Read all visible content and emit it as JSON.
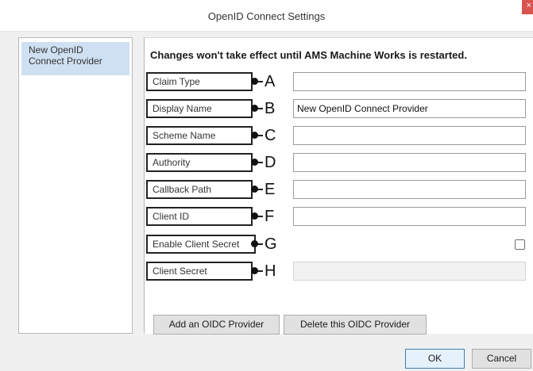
{
  "window": {
    "title": "OpenID Connect Settings",
    "close_symbol": "×"
  },
  "sidebar": {
    "items": [
      {
        "label_line1": "New OpenID",
        "label_line2": "Connect Provider"
      }
    ]
  },
  "notice": "Changes won't take effect until AMS Machine Works is restarted.",
  "fields": [
    {
      "label": "Claim Type",
      "marker": "A",
      "value": ""
    },
    {
      "label": "Display Name",
      "marker": "B",
      "value": "New OpenID Connect Provider"
    },
    {
      "label": "Scheme Name",
      "marker": "C",
      "value": ""
    },
    {
      "label": "Authority",
      "marker": "D",
      "value": ""
    },
    {
      "label": "Callback Path",
      "marker": "E",
      "value": ""
    },
    {
      "label": "Client ID",
      "marker": "F",
      "value": ""
    },
    {
      "label": "Enable Client Secret",
      "marker": "G",
      "checked": false
    },
    {
      "label": "Client Secret",
      "marker": "H",
      "value": "",
      "disabled": true
    }
  ],
  "actions": {
    "add_label": "Add an OIDC Provider",
    "delete_label": "Delete this OIDC Provider"
  },
  "footer": {
    "ok_label": "OK",
    "cancel_label": "Cancel"
  },
  "colors": {
    "close_button": "#d9534f",
    "selected_item": "#cfe0f2",
    "default_button_border": "#3c7fb1"
  }
}
